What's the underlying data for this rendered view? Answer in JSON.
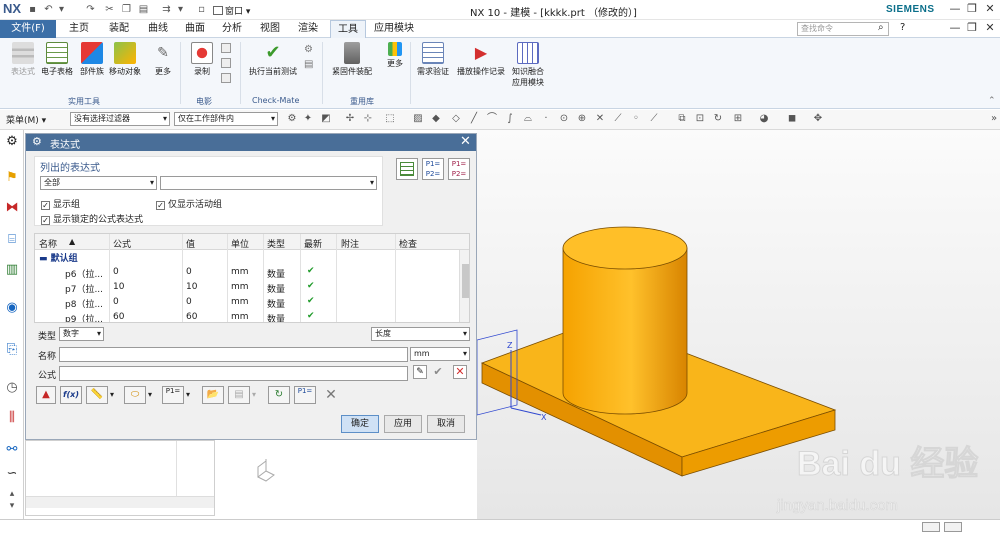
{
  "app": {
    "logo": "NX",
    "window_title": "NX 10 - 建模 - [kkkk.prt （修改的）]",
    "brand": "SIEMENS",
    "window_menu": "窗口",
    "search_placeholder": "查找命令"
  },
  "menu": {
    "file": "文件(F)",
    "tabs": [
      "主页",
      "装配",
      "曲线",
      "曲面",
      "分析",
      "视图",
      "渲染",
      "工具",
      "应用模块"
    ],
    "active_tab": "工具"
  },
  "ribbon": {
    "buttons": [
      "表达式",
      "电子表格",
      "部件族",
      "移动对象",
      "更多",
      "录制",
      "执行当前测试",
      "紧固件装配",
      "更多",
      "需求验证",
      "播放操作记录",
      "知识融合",
      "应用模块"
    ],
    "groups": [
      "实用工具",
      "电影",
      "Check-Mate",
      "重用库"
    ]
  },
  "toolbar2": {
    "menu_label": "菜单(M)",
    "filter": "没有选择过滤器",
    "scope": "仅在工作部件内"
  },
  "dialog": {
    "title": "表达式",
    "section_label": "列出的表达式",
    "list_select": "全部",
    "list_select2": "",
    "cb_show_groups": "显示组",
    "cb_active_only": "仅显示活动组",
    "cb_locked": "显示锁定的公式表达式",
    "columns": [
      "名称",
      "公式",
      "值",
      "单位",
      "类型",
      "最新",
      "附注",
      "检查"
    ],
    "group_name": "默认组",
    "rows": [
      {
        "name": "p6（拉...",
        "formula": "0",
        "value": "0",
        "unit": "mm",
        "type": "数量"
      },
      {
        "name": "p7（拉...",
        "formula": "10",
        "value": "10",
        "unit": "mm",
        "type": "数量"
      },
      {
        "name": "p8（拉...",
        "formula": "0",
        "value": "0",
        "unit": "mm",
        "type": "数量"
      },
      {
        "name": "p9（拉...",
        "formula": "60",
        "value": "60",
        "unit": "mm",
        "type": "数量"
      }
    ],
    "type_label": "类型",
    "type_value": "数字",
    "dimension_value": "长度",
    "name_label": "名称",
    "unit_value": "mm",
    "formula_label": "公式",
    "fx_label": "f(x)",
    "ok": "确定",
    "apply": "应用",
    "cancel": "取消"
  },
  "colors": {
    "accent": "#3c6fa7",
    "dialog_title": "#496e98",
    "model_top": "#f8b819",
    "model_side": "#e58f00"
  }
}
